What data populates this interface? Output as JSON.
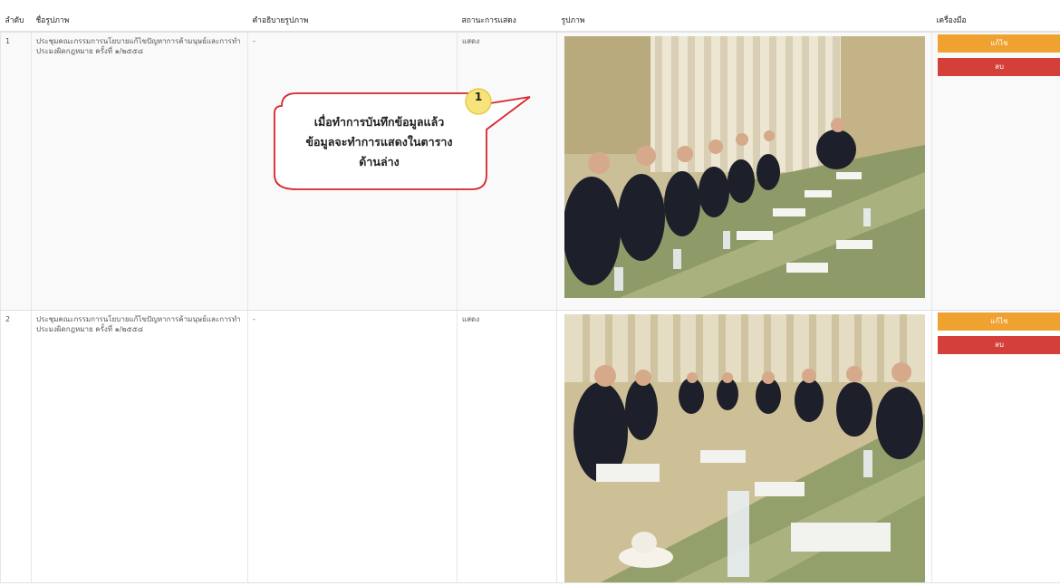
{
  "columns": {
    "no": "ลำดับ",
    "name": "ชื่อรูปภาพ",
    "desc": "คำอธิบายรูปภาพ",
    "status": "สถานะการแสดง",
    "image": "รูปภาพ",
    "tools": "เครื่องมือ"
  },
  "rows": [
    {
      "no": "1",
      "name": "ประชุมคณะกรรมการนโยบายแก้ไขปัญหาการค้ามนุษย์และการทำประมงผิดกฎหมาย ครั้งที่ ๑/๒๕๕๘",
      "desc": "-",
      "status": "แสดง",
      "edit_label": "แก้ไข",
      "delete_label": "ลบ"
    },
    {
      "no": "2",
      "name": "ประชุมคณะกรรมการนโยบายแก้ไขปัญหาการค้ามนุษย์และการทำประมงผิดกฎหมาย ครั้งที่ ๑/๒๕๕๘",
      "desc": "-",
      "status": "แสดง",
      "edit_label": "แก้ไข",
      "delete_label": "ลบ"
    }
  ],
  "callout": {
    "number": "1",
    "line1": "เมื่อทำการบันทึกข้อมูลแล้ว",
    "line2": "ข้อมูลจะทำการแสดงในตาราง",
    "line3": "ด้านล่าง"
  },
  "colors": {
    "edit": "#f0a231",
    "delete": "#d43f3a",
    "callout_border": "#d9242b",
    "badge": "#f6e37a"
  }
}
